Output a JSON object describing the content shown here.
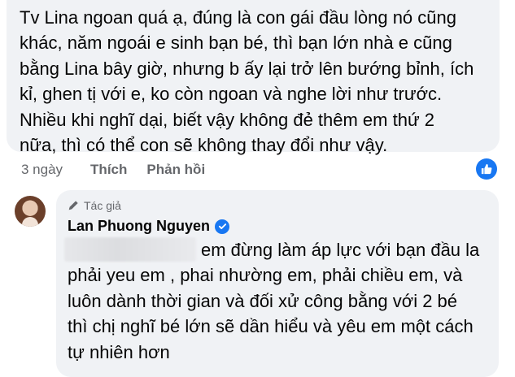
{
  "comment": {
    "lines": [
      "Tv Lina ngoan quá ạ, đúng là con gái đầu lòng nó cũng",
      "khác, năm ngoái e sinh bạn bé, thì bạn lớn nhà e cũng",
      "bằng Lina bây giờ, nhưng b ấy lại trở lên bướng bỉnh, ích",
      "kỉ, ghen tị với e, ko còn ngoan và nghe lời như trước.",
      "Nhiều khi nghĩ dại, biết vậy không đẻ thêm em thứ 2",
      "nữa, thì có thể con sẽ không thay đổi như vậy."
    ],
    "time": "3 ngày",
    "like_label": "Thích",
    "reply_label": "Phản hồi",
    "reaction_icon": "like-icon"
  },
  "reply": {
    "author_tag": "Tác giả",
    "author_name": "Lan Phuong Nguyen",
    "verified_icon": "verified-check-icon",
    "lines": [
      "em đừng làm áp lực với bạn đầu la",
      "phải yeu em , phai nhường em, phải chiều em, và",
      "luôn dành thời gian và đối xử công bằng với 2 bé",
      "thì chị nghĩ bé lớn sẽ dần hiểu và yêu em một cách",
      "tự nhiên hơn"
    ]
  },
  "colors": {
    "bubble_bg": "#f0f2f5",
    "secondary_text": "#65676b",
    "accent": "#1877f2"
  }
}
